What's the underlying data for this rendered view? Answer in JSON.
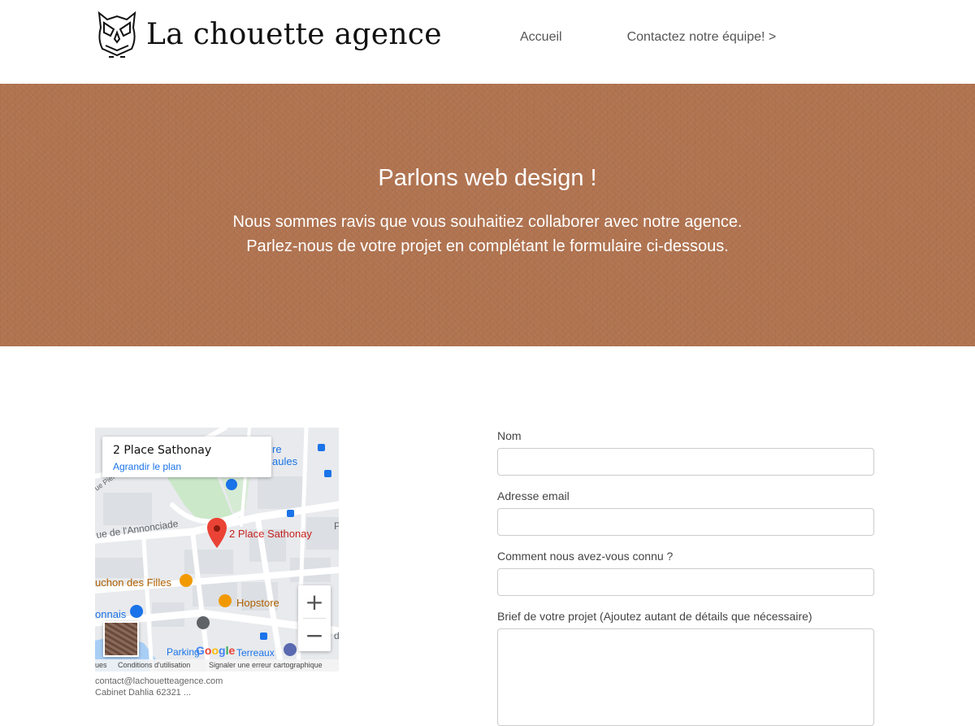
{
  "header": {
    "logo_text": "La chouette agence",
    "nav": {
      "home": "Accueil",
      "contact": "Contactez notre équipe! >"
    }
  },
  "hero": {
    "title": "Parlons web design !",
    "line1": "Nous sommes ravis que vous souhaitiez collaborer avec notre agence.",
    "line2": "Parlez-nous de votre projet en complétant le formulaire ci-dessous.",
    "background_color": "#b17451"
  },
  "map": {
    "place_title": "2 Place Sathonay",
    "enlarge_link": "Agrandir le plan",
    "marker_label": "2 Place Sathonay",
    "labels": {
      "street_annonciade": "ue de l'Annonciade",
      "bouchon": "uchon des Filles",
      "hopstore": "Hopstore",
      "parking": "Parking",
      "terreaux": "Terreaux",
      "onnais": "onnais",
      "aules": "aules",
      "re": "re",
      "rue_pierre": "ue Pier",
      "right_p": "P",
      "right_d": "d"
    },
    "zoom_in": "+",
    "zoom_out": "−",
    "google_letters": [
      "G",
      "o",
      "o",
      "g",
      "l",
      "e"
    ],
    "footer": {
      "keyboard": "ues",
      "terms": "Conditions d'utilisation",
      "report": "Signaler une erreur cartographique"
    }
  },
  "contact": {
    "email": "contact@lachouetteagence.com",
    "cut_line": "Cabinet Dahlia 62321 ..."
  },
  "form": {
    "name_label": "Nom",
    "email_label": "Adresse email",
    "source_label": "Comment nous avez-vous connu ?",
    "brief_label": "Brief de votre projet (Ajoutez autant de détails que nécessaire)",
    "name_value": "",
    "email_value": "",
    "source_value": "",
    "brief_value": ""
  }
}
